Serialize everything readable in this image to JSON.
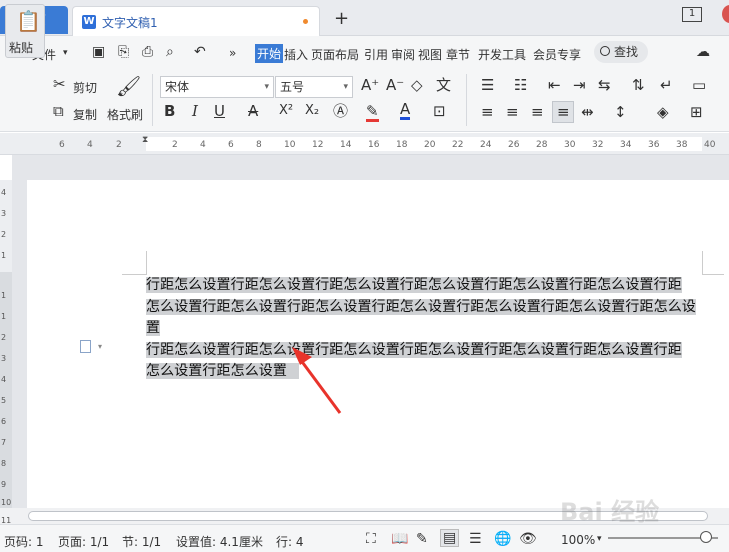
{
  "tabs": {
    "home": "首页",
    "document": "文字文稿1",
    "doc_icon": "W",
    "new_tab": "+",
    "window_count": "1"
  },
  "menu": {
    "hamburger": "≡",
    "file": "文件",
    "more": "»",
    "items": [
      "开始",
      "插入",
      "页面布局",
      "引用",
      "审阅",
      "视图",
      "章节",
      "开发工具",
      "会员专享"
    ],
    "search": "查找"
  },
  "toolbar": {
    "paste": "粘贴",
    "cut": "剪切",
    "copy": "复制",
    "format_painter": "格式刷",
    "font_name": "宋体",
    "font_size": "五号",
    "bold": "B",
    "italic": "I",
    "underline": "U",
    "strike": "A",
    "superscript": "X²",
    "subscript": "X₂",
    "font_color": "A"
  },
  "ruler": {
    "numbers": [
      "6",
      "4",
      "2",
      "2",
      "4",
      "6",
      "8",
      "10",
      "12",
      "14",
      "16",
      "18",
      "20",
      "22",
      "24",
      "26",
      "28",
      "30",
      "32",
      "34",
      "36",
      "38",
      "40"
    ]
  },
  "vruler": {
    "numbers": [
      "4",
      "3",
      "2",
      "1",
      "1",
      "1",
      "2",
      "3",
      "4",
      "5",
      "6",
      "7",
      "8",
      "9",
      "10",
      "11"
    ]
  },
  "document": {
    "lines": [
      "行距怎么设置行距怎么设置行距怎么设置行距怎么设置行距怎么设置行距怎么设置行距",
      "怎么设置行距怎么设置行距怎么设置行距怎么设置行距怎么设置行距怎么设置行距怎么设置",
      "行距怎么设置行距怎么设置行距怎么设置行距怎么设置行距怎么设置行距怎么设置行距",
      "怎么设置行距怎么设置"
    ]
  },
  "status": {
    "page_code": "页码: 1",
    "pages": "页面: 1/1",
    "section": "节: 1/1",
    "setting": "设置值: 4.1厘米",
    "row": "行: 4",
    "zoom": "100%"
  },
  "watermark": "Bai 经验"
}
